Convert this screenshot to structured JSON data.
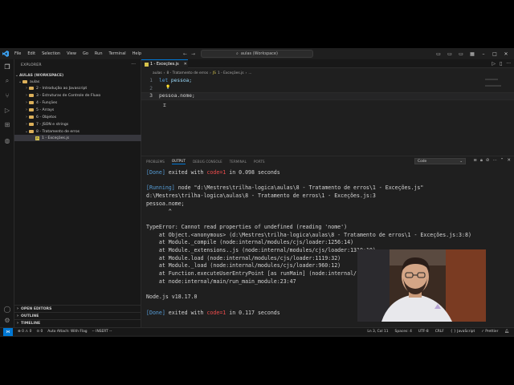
{
  "title_bar": {
    "menu": [
      "File",
      "Edit",
      "Selection",
      "View",
      "Go",
      "Run",
      "Terminal",
      "Help"
    ],
    "search_text": "aulas (Workspace)",
    "back_icon": "arrow-left-icon",
    "forward_icon": "arrow-right-icon"
  },
  "explorer": {
    "header": "EXPLORER",
    "workspace": "AULAS (WORKSPACE)",
    "root": "aulas",
    "items": [
      {
        "label": "2 - Introdução ao Javascript",
        "type": "folder"
      },
      {
        "label": "3 - Estruturas de Controle de Fluxo",
        "type": "folder"
      },
      {
        "label": "4 - Funções",
        "type": "folder"
      },
      {
        "label": "5 - Arrays",
        "type": "folder"
      },
      {
        "label": "6 - Objetos",
        "type": "folder"
      },
      {
        "label": "7 - JSON e strings",
        "type": "folder"
      },
      {
        "label": "8 - Tratamento de erros",
        "type": "folder-open"
      },
      {
        "label": "1 - Exceções.js",
        "type": "file",
        "selected": true
      }
    ],
    "sections": [
      "OPEN EDITORS",
      "OUTLINE",
      "TIMELINE"
    ]
  },
  "editor": {
    "tab_label": "1 - Exceções.js",
    "breadcrumb": [
      "aulas",
      "8 - Tratamento de erros",
      "1 - Exceções.js",
      "..."
    ],
    "lines": [
      {
        "number": "1",
        "keyword": "let",
        "text": " pessoa;"
      },
      {
        "number": "2",
        "keyword": "",
        "text": ""
      },
      {
        "number": "3",
        "keyword": "",
        "text": "pessoa.nome;"
      }
    ]
  },
  "panel": {
    "tabs": [
      "PROBLEMS",
      "OUTPUT",
      "DEBUG CONSOLE",
      "TERMINAL",
      "PORTS"
    ],
    "active_tab": "OUTPUT",
    "output_channel": "Code",
    "output_lines": [
      {
        "text": "[Done] exited with code=1 in 0.098 seconds",
        "style": "done"
      },
      {
        "text": "",
        "style": ""
      },
      {
        "text": "[Running] node \"d:\\Mestres\\trilha-logica\\aulas\\8 - Tratamento de erros\\1 - Exceções.js\"",
        "style": "running"
      },
      {
        "text": "d:\\Mestres\\trilha-logica\\aulas\\8 - Tratamento de erros\\1 - Exceções.js:3",
        "style": ""
      },
      {
        "text": "pessoa.nome;",
        "style": ""
      },
      {
        "text": "       ^",
        "style": ""
      },
      {
        "text": "",
        "style": ""
      },
      {
        "text": "TypeError: Cannot read properties of undefined (reading 'nome')",
        "style": ""
      },
      {
        "text": "    at Object.<anonymous> (d:\\Mestres\\trilha-logica\\aulas\\8 - Tratamento de erros\\1 - Exceções.js:3:8)",
        "style": ""
      },
      {
        "text": "    at Module._compile (node:internal/modules/cjs/loader:1256:14)",
        "style": ""
      },
      {
        "text": "    at Module._extensions..js (node:internal/modules/cjs/loader:1310:10)",
        "style": ""
      },
      {
        "text": "    at Module.load (node:internal/modules/cjs/loader:1119:32)",
        "style": ""
      },
      {
        "text": "    at Module._load (node:internal/modules/cjs/loader:960:12)",
        "style": ""
      },
      {
        "text": "    at Function.executeUserEntryPoint [as runMain] (node:internal/",
        "style": ""
      },
      {
        "text": "    at node:internal/main/run_main_module:23:47",
        "style": ""
      },
      {
        "text": "",
        "style": ""
      },
      {
        "text": "Node.js v18.17.0",
        "style": ""
      },
      {
        "text": "",
        "style": ""
      },
      {
        "text": "[Done] exited with code=1 in 0.117 seconds",
        "style": "done"
      }
    ]
  },
  "status_bar": {
    "problems": "⊗ 0 ⚠ 0",
    "ports": "0",
    "attach": "Auto Attach: With Flag",
    "mode": "-- INSERT --",
    "position": "Ln 3, Col 11",
    "spaces": "Spaces: 4",
    "encoding": "UTF-8",
    "eol": "CRLF",
    "language": "{ } JavaScript",
    "formatter": "✓ Prettier"
  },
  "colors": {
    "accent": "#0078d4",
    "keyword": "#569cd6",
    "error": "#f14c4c",
    "background": "#1e1e1e"
  }
}
